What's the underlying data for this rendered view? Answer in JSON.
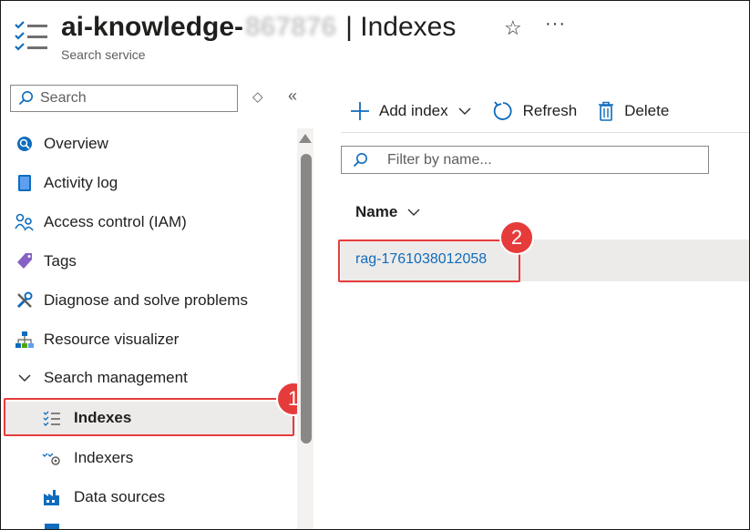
{
  "header": {
    "title_prefix": "ai-knowledge-",
    "title_blurred": "867876",
    "title_suffix": "| Indexes",
    "subtitle": "Search service",
    "more_label": "···"
  },
  "sidebar": {
    "search_placeholder": "Search",
    "items": [
      {
        "label": "Overview",
        "icon": "overview-icon"
      },
      {
        "label": "Activity log",
        "icon": "activity-log-icon"
      },
      {
        "label": "Access control (IAM)",
        "icon": "access-control-icon"
      },
      {
        "label": "Tags",
        "icon": "tag-icon"
      },
      {
        "label": "Diagnose and solve problems",
        "icon": "wrench-icon"
      },
      {
        "label": "Resource visualizer",
        "icon": "hierarchy-icon"
      },
      {
        "label": "Search management",
        "icon": "chevron-down-icon"
      },
      {
        "label": "Indexes",
        "icon": "indexes-icon"
      },
      {
        "label": "Indexers",
        "icon": "indexers-icon"
      },
      {
        "label": "Data sources",
        "icon": "data-sources-icon"
      }
    ]
  },
  "toolbar": {
    "add_index": "Add index",
    "refresh": "Refresh",
    "delete": "Delete"
  },
  "list": {
    "filter_placeholder": "Filter by name...",
    "column_name": "Name",
    "rows": [
      {
        "name": "rag-1761038012058"
      }
    ]
  },
  "annotations": {
    "step1": "1",
    "step2": "2"
  },
  "colors": {
    "accent": "#0f6cbd",
    "highlight": "#e63b3b",
    "selected_bg": "#edebe9"
  }
}
